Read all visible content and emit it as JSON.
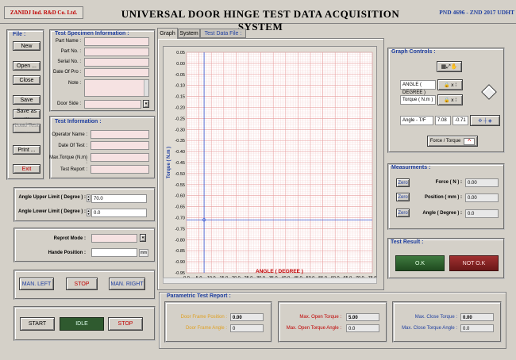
{
  "header": {
    "company": "ZANIDJ Ind. R&D Co. Ltd.",
    "title": "UNIVERSAL DOOR HINGE TEST DATA ACQUISITION SYSTEM",
    "standard": "PND 4696 - ZND 2017 UDHT"
  },
  "file": {
    "title": "File :",
    "new": "New",
    "open": "Open ...",
    "close": "Close",
    "save": "Save",
    "save_as": "Save as ...",
    "load_test": "Load Test ...",
    "print": "Print ...",
    "exit": "Exit"
  },
  "specimen": {
    "title": "Test Specimen Information :",
    "part_name": "Part Name :",
    "part_no": "Part No. :",
    "serial_no": "Serial No. :",
    "date_of_pro": "Date Of Pro :",
    "note": "Note :",
    "door_side": "Door Side :"
  },
  "test_info": {
    "title": "Test Information :",
    "operator": "Operator Name :",
    "date": "Date Of Test :",
    "max_torque": "Max.Torque (N.m) :",
    "report": "Test  Report :"
  },
  "limits": {
    "upper_label": "Angle Upper Limit ( Degree ) :",
    "upper_value": "70.0",
    "lower_label": "Angle Lower Limit ( Degree ) :",
    "lower_value": "0.0"
  },
  "mode": {
    "report_mode": "Reprot  Mode :",
    "hande_position": "Hande Position :",
    "hande_unit": "mm"
  },
  "motion": {
    "man_left": "MAN. LEFT",
    "stop": "STOP",
    "man_right": "MAN. RIGHT"
  },
  "run": {
    "start": "START",
    "idle": "IDLE",
    "stop": "STOP"
  },
  "tabs": {
    "graph": "Graph",
    "system": "System",
    "test_data": "Test Data File :"
  },
  "graph_controls": {
    "title": "Graph Controls :",
    "x_select": "ANGLE ( DEGREE )",
    "y_select": "Torque ( N.m )",
    "cursor_name": "Angle - T/F",
    "cursor_x": "7.08",
    "cursor_y": "-0.71",
    "force_torque": "Force / Torque"
  },
  "measurements": {
    "title": "Measurments :",
    "zero": "Zero",
    "force_label": "Force ( N ) :",
    "force_value": "0.00",
    "position_label": "Position ( mm ) :",
    "position_value": "0.00",
    "angle_label": "Angle ( Degree ) :",
    "angle_value": "0.0"
  },
  "result": {
    "title": "Test Result :",
    "ok": "O.K",
    "not_ok": "NOT O.K"
  },
  "parametric": {
    "title": "Parametric Test Report :",
    "door_frame_position": "Door Frame Position :",
    "dfp_value": "0.00",
    "door_frame_angle": "Door Frame Angle :",
    "dfa_value": "0",
    "max_open_torque": "Max. Open Torque :",
    "mot_value": "5.00",
    "max_open_torque_angle": "Max. Open Torque Angle :",
    "mota_value": "0.0",
    "max_close_torque": "Max. Close Torque :",
    "mct_value": "0.00",
    "max_close_torque_angle": "Max. Close Torque Angle :",
    "mcta_value": "0.0"
  },
  "chart_data": {
    "type": "line",
    "xlabel": "ANGLE ( DEGREE )",
    "ylabel": "Torque ( N.m )",
    "xlim": [
      0,
      75
    ],
    "ylim": [
      -0.95,
      0.05
    ],
    "x_ticks": [
      "0.0",
      "5.0",
      "10.0",
      "15.0",
      "20.0",
      "25.0",
      "30.0",
      "35.0",
      "40.0",
      "45.0",
      "50.0",
      "55.0",
      "60.0",
      "65.0",
      "70.0",
      "75.0"
    ],
    "y_ticks": [
      "0.05",
      "0.00",
      "-0.05",
      "-0.10",
      "-0.15",
      "-0.20",
      "-0.25",
      "-0.30",
      "-0.35",
      "-0.40",
      "-0.45",
      "-0.50",
      "-0.55",
      "-0.60",
      "-0.65",
      "-0.70",
      "-0.75",
      "-0.80",
      "-0.85",
      "-0.90",
      "-0.95"
    ],
    "cursor": {
      "x": 7.08,
      "y": -0.71
    },
    "series": [],
    "grid": true,
    "colors": {
      "grid": "#e8a0a0",
      "cursor": "#3050d0",
      "axis_label": "#c00000"
    }
  }
}
